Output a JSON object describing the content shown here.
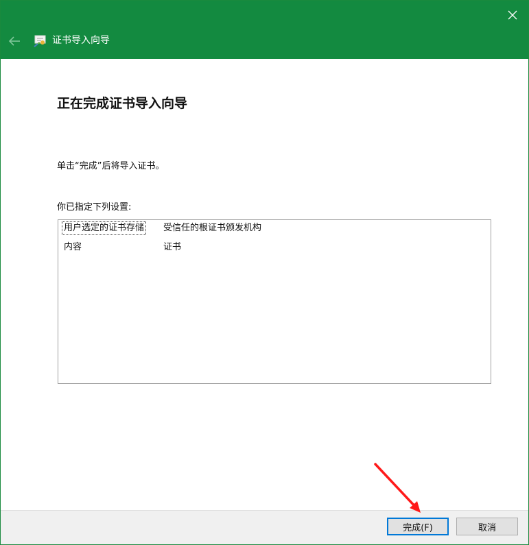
{
  "window": {
    "title": "证书导入向导",
    "accent_color": "#138a40"
  },
  "page": {
    "heading": "正在完成证书导入向导",
    "instruction": "单击“完成”后将导入证书。",
    "settings_label": "你已指定下列设置:"
  },
  "settings": [
    {
      "key": "用户选定的证书存储",
      "value": "受信任的根证书颁发机构"
    },
    {
      "key": "内容",
      "value": "证书"
    }
  ],
  "buttons": {
    "finish": "完成(F)",
    "cancel": "取消"
  },
  "icons": {
    "close": "close-icon",
    "back": "back-arrow-icon",
    "wizard": "certificate-wizard-icon"
  }
}
